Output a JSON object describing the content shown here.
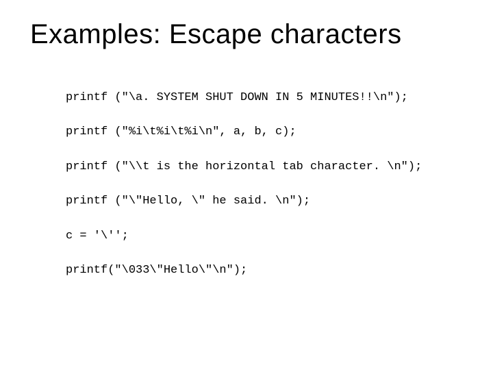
{
  "title": "Examples: Escape characters",
  "lines": [
    "printf (\"\\a. SYSTEM SHUT DOWN IN 5 MINUTES!!\\n\");",
    "printf (\"%i\\t%i\\t%i\\n\", a, b, c);",
    "printf (\"\\\\t is the horizontal tab character. \\n\");",
    "printf (\"\\\"Hello, \\\" he said. \\n\");",
    "c = '\\'';",
    "printf(\"\\033\\\"Hello\\\"\\n\");"
  ]
}
